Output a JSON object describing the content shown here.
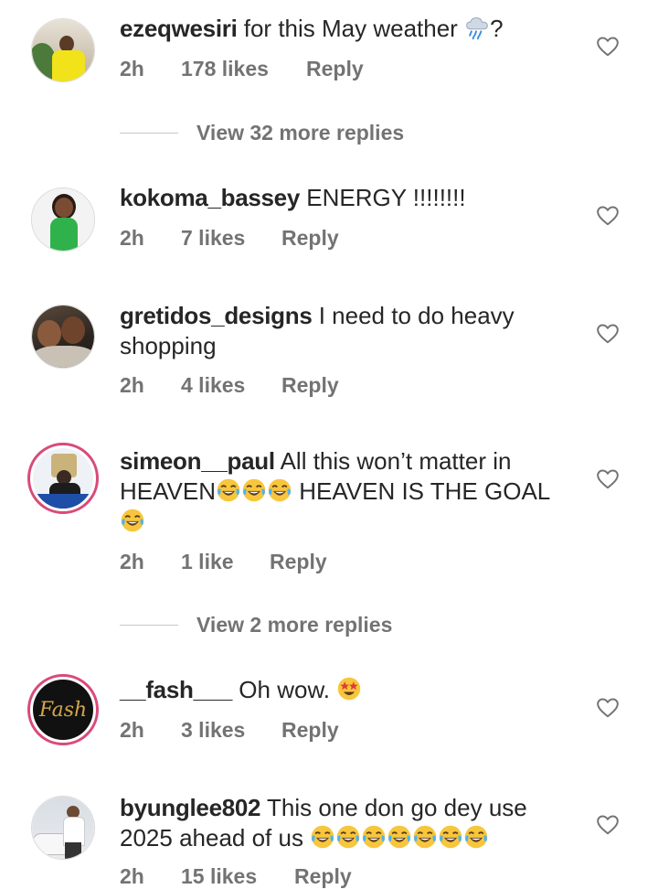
{
  "comments": [
    {
      "username": "ezeqwesiri",
      "text": "for this May weather",
      "suffix": "?",
      "time": "2h",
      "likes": "178 likes",
      "reply": "Reply"
    },
    {
      "username": "kokoma_bassey",
      "text": "ENERGY !!!!!!!!",
      "time": "2h",
      "likes": "7 likes",
      "reply": "Reply"
    },
    {
      "username": "gretidos_designs",
      "text": "I need to do heavy shopping",
      "time": "2h",
      "likes": "4 likes",
      "reply": "Reply"
    },
    {
      "username": "simeon__paul",
      "text1": "All this won’t matter in HEAVEN",
      "text2": "HEAVEN IS THE GOAL",
      "time": "2h",
      "likes": "1 like",
      "reply": "Reply"
    },
    {
      "username": "__fash___",
      "text": "Oh wow.",
      "time": "2h",
      "likes": "3 likes",
      "reply": "Reply"
    },
    {
      "username": "byunglee802",
      "text": "This one don go dey use 2025 ahead of us",
      "time": "2h",
      "likes": "15 likes",
      "reply": "Reply"
    }
  ],
  "view_more": [
    "View 32 more replies",
    "View 2 more replies"
  ],
  "avatar_logo_text": "Fash",
  "colors": {
    "text": "#262626",
    "secondary": "#737373",
    "story_ring": "#d94a7a"
  },
  "icons": [
    "heart-outline-icon",
    "rain-cloud-emoji",
    "laughing-emoji",
    "star-eyes-emoji"
  ]
}
